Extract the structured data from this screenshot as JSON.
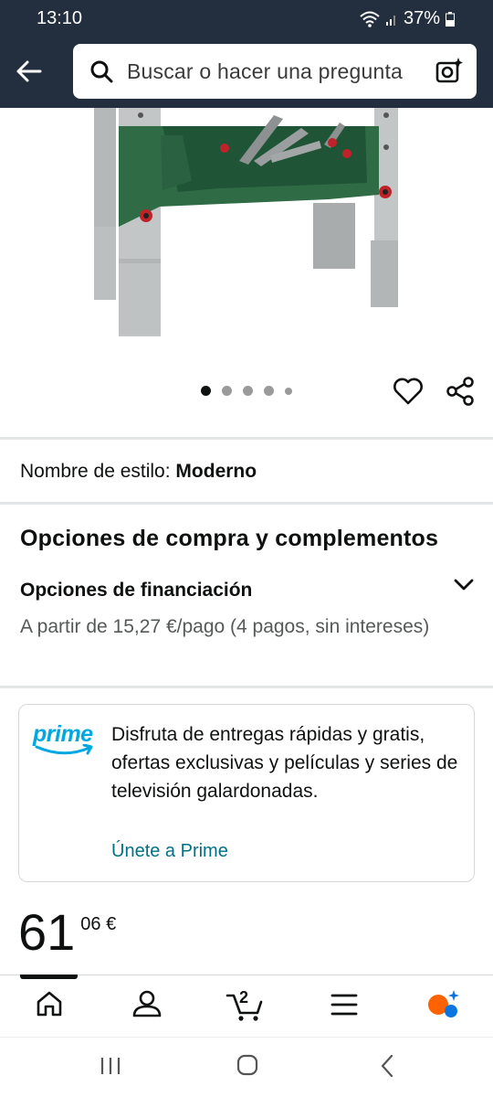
{
  "status": {
    "time": "13:10",
    "battery": "37%"
  },
  "search": {
    "placeholder": "Buscar o hacer una pregunta"
  },
  "product": {
    "style_label": "Nombre de estilo:",
    "style_value": "Moderno",
    "image_count": 5,
    "active_image": 1
  },
  "purchase": {
    "title": "Opciones de compra y complementos",
    "financing_title": "Opciones de financiación",
    "financing_text": "A partir de 15,27 €/pago (4 pagos, sin intereses)"
  },
  "prime": {
    "logo": "prime",
    "text": "Disfruta de entregas rápidas y gratis, ofertas exclusivas y películas y series de televisión galardonadas.",
    "link": "Únete a Prime"
  },
  "price": {
    "whole": "61",
    "fraction": "06 €"
  },
  "cart": {
    "count": "2"
  },
  "colors": {
    "header": "#232f3e",
    "link": "#007185",
    "prime_blue": "#00a8e1",
    "alexa_orange": "#ff6200"
  }
}
